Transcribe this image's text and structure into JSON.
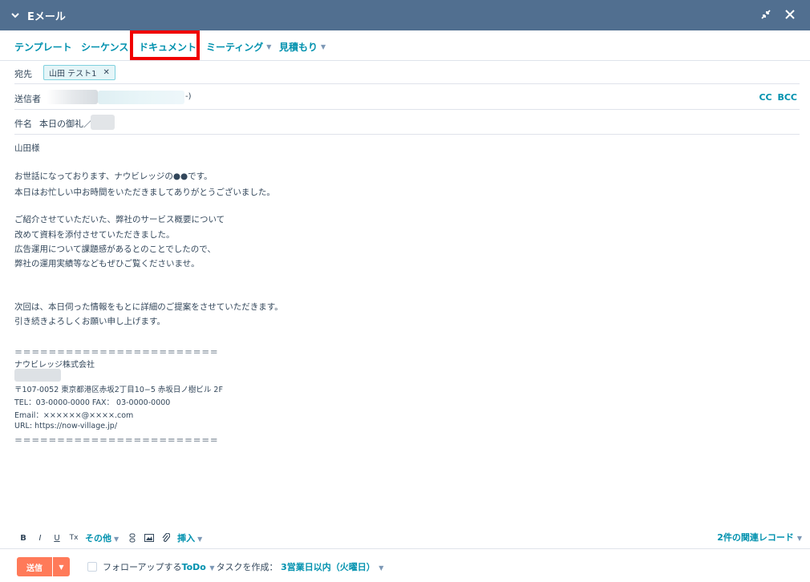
{
  "header": {
    "title": "Eメール"
  },
  "tabs": [
    {
      "label": "テンプレート"
    },
    {
      "label": "シーケンス"
    },
    {
      "label": "ドキュメント"
    },
    {
      "label": "ミーティング"
    },
    {
      "label": "見積もり"
    }
  ],
  "fields": {
    "to_label": "宛先",
    "to_chip": "山田 テスト1",
    "from_label": "送信者",
    "from_suffix": "-)",
    "subject_label": "件名",
    "subject_value": "本日の御礼／",
    "cc": "CC",
    "bcc": "BCC"
  },
  "body": {
    "lines": [
      "山田様",
      "お世話になっております、ナウビレッジの●●です。",
      "本日はお忙しい中お時間をいただきましてありがとうございました。",
      "ご紹介させていただいた、弊社のサービス概要について",
      "改めて資料を添付させていただきました。",
      "広告運用について課題感があるとのことでしたので、",
      "弊社の運用実績等などもぜひご覧くださいませ。",
      "次回は、本日伺った情報をもとに詳細のご提案をさせていただきます。",
      "引き続きよろしくお願い申し上げます。"
    ]
  },
  "signature": {
    "separator": "＝＝＝＝＝＝＝＝＝＝＝＝＝＝＝＝＝＝＝＝＝＝＝＝",
    "company": "ナウビレッジ株式会社",
    "address": "〒107-0052 東京都港区赤坂2丁目10−5 赤坂日ノ樹ビル 2F",
    "tel": "TEL：03-0000-0000 FAX： 03-0000-0000",
    "email": "Email：××××××@××××.com",
    "url": "URL: https://now-village.jp/"
  },
  "toolbar": {
    "bold": "B",
    "italic": "I",
    "underline": "U",
    "clear": "Tx",
    "more": "その他",
    "insert": "挿入",
    "associations": "2件の関連レコード"
  },
  "footer": {
    "send": "送信",
    "followup_prefix": "フォローアップする",
    "todo": "ToDo",
    "followup_mid": "タスクを作成：",
    "due": "3営業日以内（火曜日）"
  }
}
